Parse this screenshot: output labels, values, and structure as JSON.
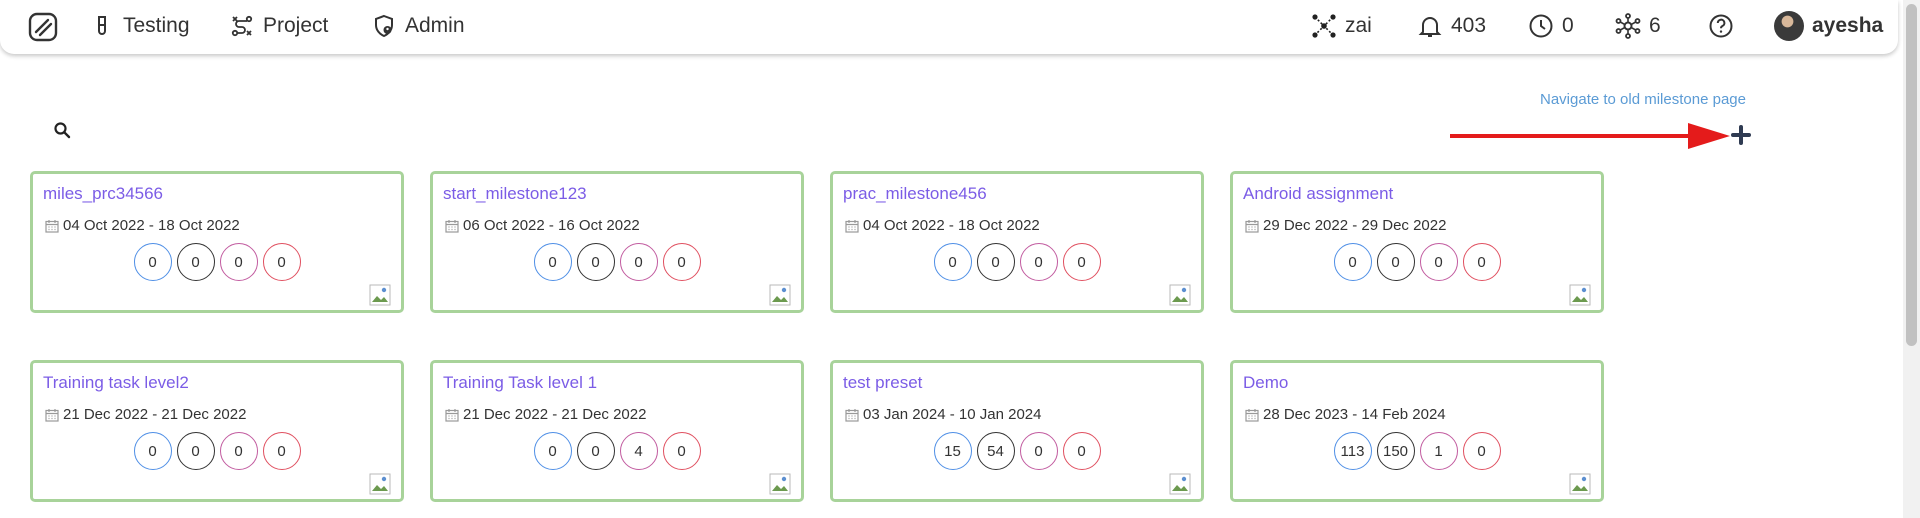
{
  "nav": {
    "items": [
      {
        "label": "Testing",
        "icon": "test-tube-icon"
      },
      {
        "label": "Project",
        "icon": "project-flow-icon"
      },
      {
        "label": "Admin",
        "icon": "admin-shield-icon"
      }
    ]
  },
  "status": {
    "ai_label": "zai",
    "notifications": "403",
    "pending": "0",
    "connections": "6",
    "user_name": "ayesha"
  },
  "page": {
    "old_milestone_link": "Navigate to old milestone page"
  },
  "colors": {
    "accent_title": "#7b5ce6",
    "card_border": "#a8d39a",
    "arrow": "#e41b1b",
    "count_borders": [
      "#4f8fe6",
      "#333333",
      "#c25ca0",
      "#e05060"
    ]
  },
  "milestones": [
    {
      "title": "miles_prc34566",
      "dates": "04 Oct 2022 - 18 Oct 2022",
      "counts": [
        "0",
        "0",
        "0",
        "0"
      ]
    },
    {
      "title": "start_milestone123",
      "dates": "06 Oct 2022 - 16 Oct 2022",
      "counts": [
        "0",
        "0",
        "0",
        "0"
      ]
    },
    {
      "title": "prac_milestone456",
      "dates": "04 Oct 2022 - 18 Oct 2022",
      "counts": [
        "0",
        "0",
        "0",
        "0"
      ]
    },
    {
      "title": "Android assignment",
      "dates": "29 Dec 2022 - 29 Dec 2022",
      "counts": [
        "0",
        "0",
        "0",
        "0"
      ]
    },
    {
      "title": "Training task level2",
      "dates": "21 Dec 2022 - 21 Dec 2022",
      "counts": [
        "0",
        "0",
        "0",
        "0"
      ]
    },
    {
      "title": "Training Task level 1",
      "dates": "21 Dec 2022 - 21 Dec 2022",
      "counts": [
        "0",
        "0",
        "4",
        "0"
      ]
    },
    {
      "title": "test preset",
      "dates": "03 Jan 2024 - 10 Jan 2024",
      "counts": [
        "15",
        "54",
        "0",
        "0"
      ]
    },
    {
      "title": "Demo",
      "dates": "28 Dec 2023 - 14 Feb 2024",
      "counts": [
        "113",
        "150",
        "1",
        "0"
      ]
    }
  ]
}
